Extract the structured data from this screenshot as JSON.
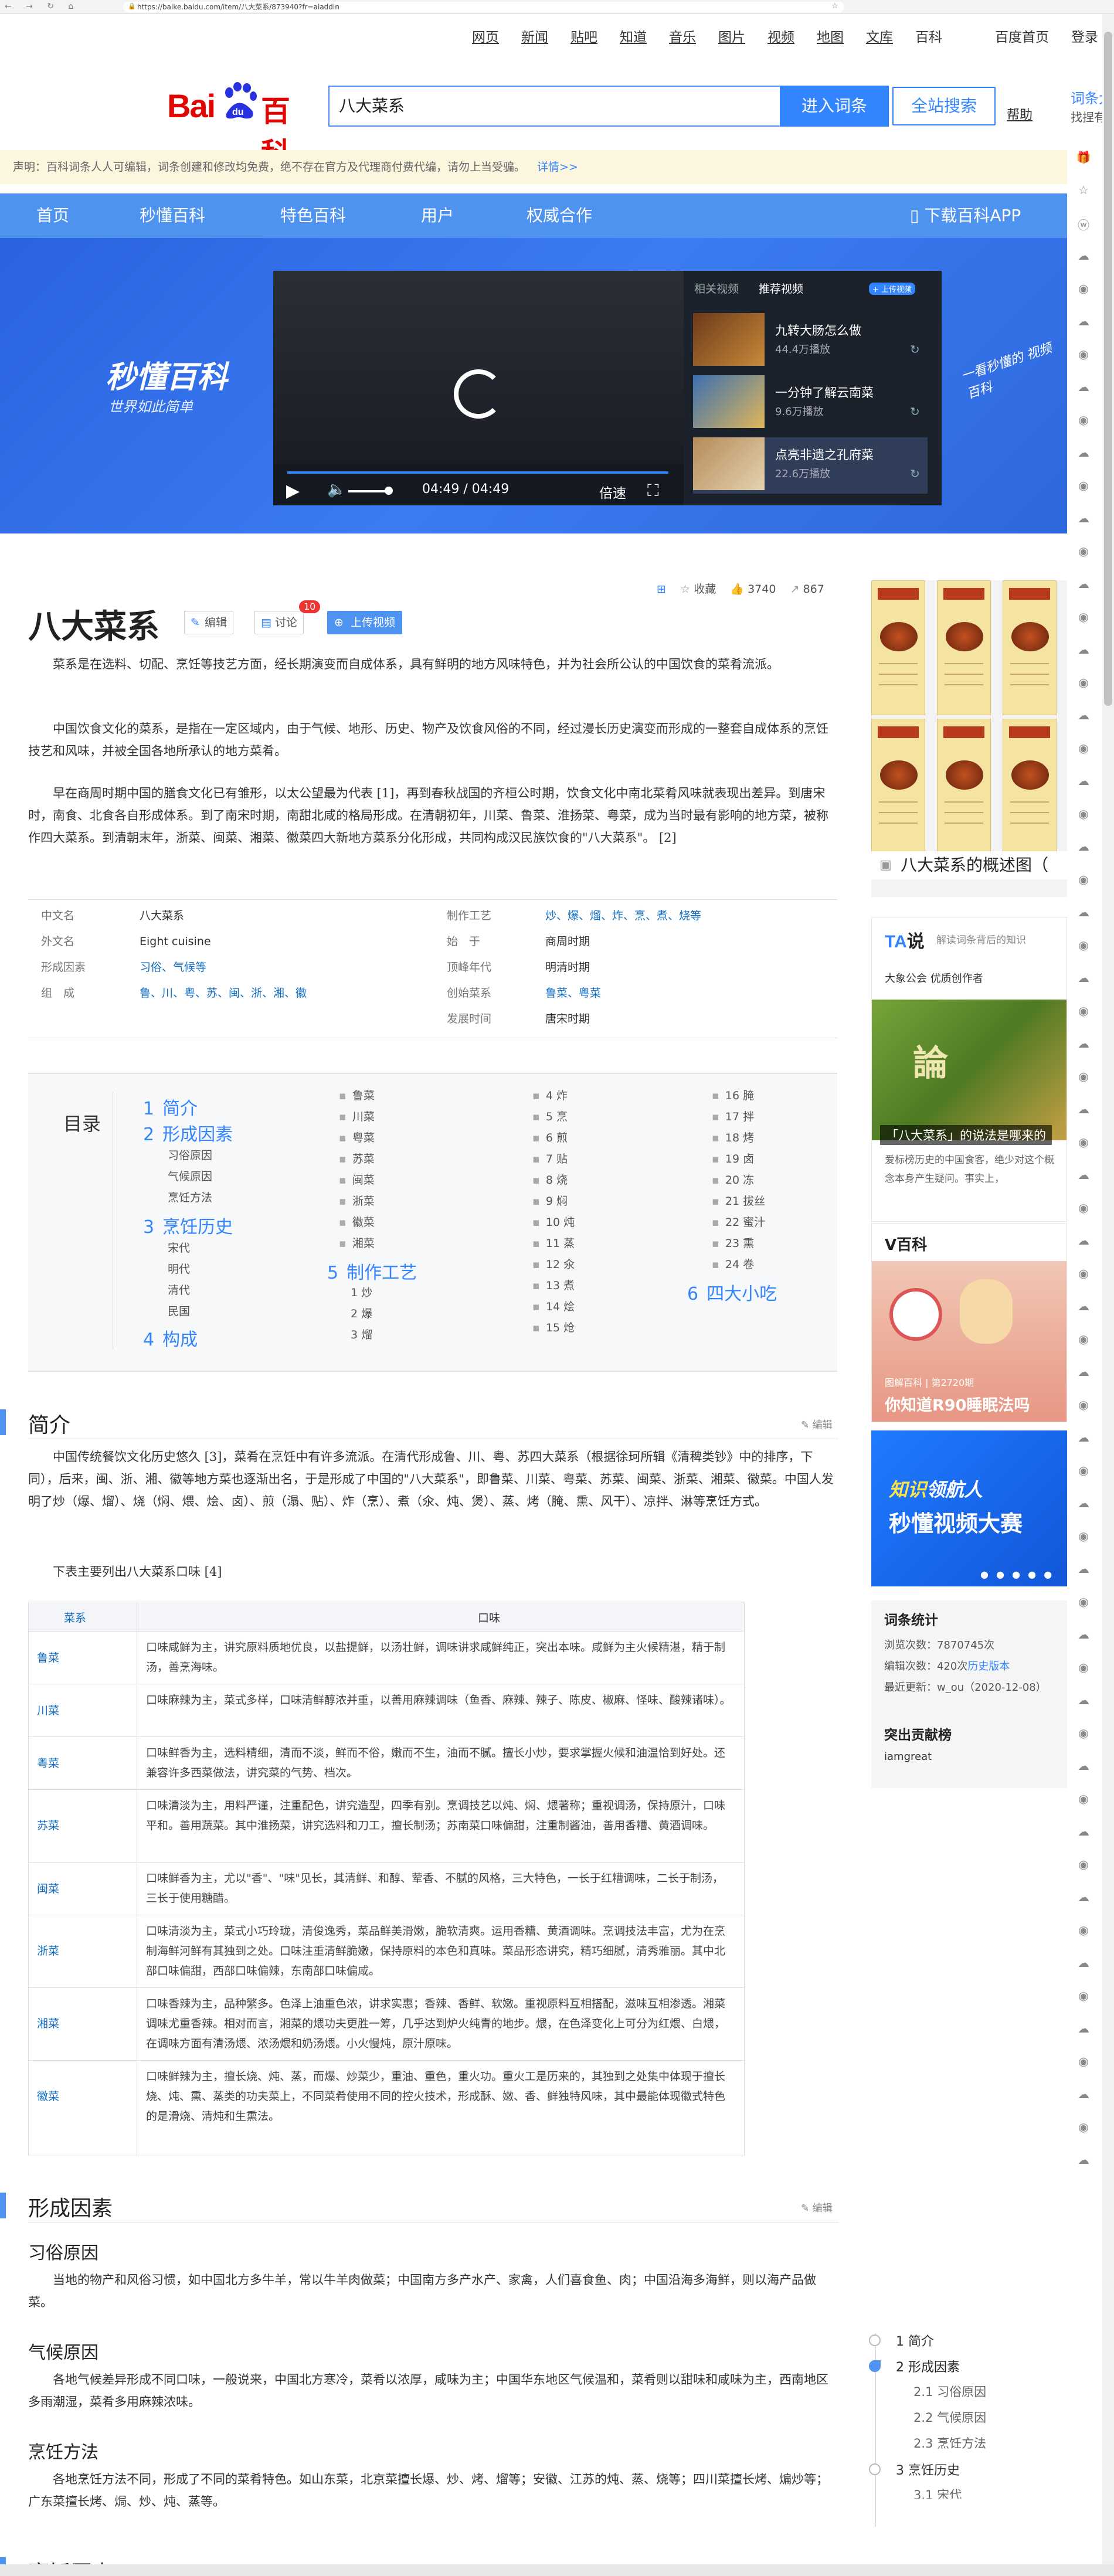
{
  "browser": {
    "url": "https://baike.baidu.com/item/八大菜系/873940?fr=aladdin",
    "nav_icons": "← → ↻ ⌂"
  },
  "toplinks": [
    {
      "label": "网页"
    },
    {
      "label": "新闻"
    },
    {
      "label": "贴吧"
    },
    {
      "label": "知道"
    },
    {
      "label": "音乐"
    },
    {
      "label": "图片"
    },
    {
      "label": "视频"
    },
    {
      "label": "地图"
    },
    {
      "label": "文库"
    },
    {
      "label": "百科"
    },
    {
      "label": "百度首页"
    },
    {
      "label": "登录"
    }
  ],
  "header": {
    "logo_bai": "Bai",
    "logo_du": "du",
    "logo_baike": "百科",
    "search_value": "八大菜系",
    "enter_button": "进入词条",
    "all_search_button": "全站搜索",
    "help": "帮助",
    "right_title": "词条大",
    "right_sub": "找捏有"
  },
  "notice": {
    "text": "声明：百科词条人人可编辑，词条创建和修改均免费，绝不存在官方及代理商付费代编，请勿上当受骗。",
    "more": "详情>>"
  },
  "nav": {
    "items": [
      {
        "label": "首页"
      },
      {
        "label": "秒懂百科"
      },
      {
        "label": "特色百科"
      },
      {
        "label": "用户"
      },
      {
        "label": "权威合作"
      }
    ],
    "download": "下载百科APP"
  },
  "banner": {
    "brand": "秒懂百科",
    "slogan": "世界如此简单",
    "handwriting": "一看秒懂的 视频百科",
    "player": {
      "time": "04:49 / 04:49",
      "speed": "倍速",
      "progress_fraction": 1.0
    },
    "video_tabs": {
      "related": "相关视频",
      "recommended": "推荐视频",
      "upload": "+ 上传视频"
    },
    "videos": [
      {
        "title": "九转大肠怎么做",
        "plays": "44.4万播放"
      },
      {
        "title": "一分钟了解云南菜",
        "plays": "9.6万播放"
      },
      {
        "title": "点亮非遗之孔府菜",
        "plays": "22.6万播放"
      }
    ]
  },
  "title_area": {
    "title": "八大菜系",
    "edit": "编辑",
    "discuss": "讨论",
    "discuss_badge": "10",
    "upload_video": "上传视频",
    "collect": "收藏",
    "likes": "3740",
    "shares": "867"
  },
  "intro_paragraphs": [
    "菜系是在选料、切配、烹饪等技艺方面，经长期演变而自成体系，具有鲜明的地方风味特色，并为社会所公认的中国饮食的菜肴流派。",
    "中国饮食文化的菜系，是指在一定区域内，由于气候、地形、历史、物产及饮食风俗的不同，经过漫长历史演变而形成的一整套自成体系的烹饪技艺和风味，并被全国各地所承认的地方菜肴。",
    "早在商周时期中国的膳食文化已有雏形，以太公望最为代表 [1]，再到春秋战国的齐桓公时期，饮食文化中南北菜肴风味就表现出差异。到唐宋时，南食、北食各自形成体系。到了南宋时期，南甜北咸的格局形成。在清朝初年，川菜、鲁菜、淮扬菜、粤菜，成为当时最有影响的地方菜，被称作四大菜系。到清朝末年，浙菜、闽菜、湘菜、徽菜四大新地方菜系分化形成，共同构成汉民族饮食的\"八大菜系\"。 [2]"
  ],
  "info": {
    "left": [
      {
        "key": "中文名",
        "value": "八大菜系"
      },
      {
        "key": "外文名",
        "value": "Eight cuisine"
      },
      {
        "key": "形成因素",
        "value": "习俗、气候等"
      },
      {
        "key": "组　成",
        "value": "鲁、川、粤、苏、闽、浙、湘、徽"
      }
    ],
    "right": [
      {
        "key": "制作工艺",
        "value": "炒、爆、熘、炸、烹、煮、烧等"
      },
      {
        "key": "始　于",
        "value": "商周时期"
      },
      {
        "key": "顶峰年代",
        "value": "明清时期"
      },
      {
        "key": "创始菜系",
        "value": "鲁菜、粤菜"
      },
      {
        "key": "发展时间",
        "value": "唐宋时期"
      }
    ]
  },
  "toc": {
    "label": "目录",
    "main": [
      {
        "n": "1",
        "label": "简介"
      },
      {
        "n": "2",
        "label": "形成因素"
      },
      {
        "n": "3",
        "label": "烹饪历史"
      },
      {
        "n": "4",
        "label": "构成"
      },
      {
        "n": "5",
        "label": "制作工艺"
      },
      {
        "n": "6",
        "label": "四大小吃"
      }
    ],
    "sub2": [
      "习俗原因",
      "气候原因",
      "烹饪方法"
    ],
    "sub3": [
      "宋代",
      "明代",
      "清代",
      "民国"
    ],
    "col2": [
      "鲁菜",
      "川菜",
      "粤菜",
      "苏菜",
      "闽菜",
      "浙菜",
      "徽菜",
      "湘菜"
    ],
    "sub5": [
      "1 炒",
      "2 爆",
      "3 熘"
    ],
    "col3": [
      "4 炸",
      "5 烹",
      "6 煎",
      "7 贴",
      "8 烧",
      "9 焖",
      "10 炖",
      "11 蒸",
      "12 氽",
      "13 煮",
      "14 烩",
      "15 炝"
    ],
    "col4": [
      "16 腌",
      "17 拌",
      "18 烤",
      "19 卤",
      "20 冻",
      "21 拔丝",
      "22 蜜汁",
      "23 熏",
      "24 卷"
    ]
  },
  "section1": {
    "title": "简介",
    "edit": "编辑",
    "para1": "中国传统餐饮文化历史悠久 [3]，菜肴在烹饪中有许多流派。在清代形成鲁、川、粤、苏四大菜系（根据徐珂所辑《清稗类钞》中的排序，下同），后来，闽、浙、湘、徽等地方菜也逐渐出名，于是形成了中国的\"八大菜系\"，即鲁菜、川菜、粤菜、苏菜、闽菜、浙菜、湘菜、徽菜。中国人发明了炒（爆、熘）、烧（焖、煨、烩、卤）、煎（溻、贴）、炸（烹）、煮（氽、炖、煲）、蒸、烤（腌、熏、风干）、凉拌、淋等烹饪方式。",
    "para2": "下表主要列出八大菜系口味 [4]"
  },
  "flavor_table": {
    "head_cuisine": "菜系",
    "head_taste": "口味",
    "rows": [
      {
        "k": "鲁菜",
        "v": "口味咸鲜为主，讲究原料质地优良，以盐提鲜，以汤壮鲜，调味讲求咸鲜纯正，突出本味。咸鲜为主火候精湛，精于制汤，善烹海味。"
      },
      {
        "k": "川菜",
        "v": "口味麻辣为主，菜式多样，口味清鲜醇浓并重，以善用麻辣调味（鱼香、麻辣、辣子、陈皮、椒麻、怪味、酸辣诸味）。"
      },
      {
        "k": "粤菜",
        "v": "口味鲜香为主，选料精细，清而不淡，鲜而不俗，嫩而不生，油而不腻。擅长小炒，要求掌握火候和油温恰到好处。还兼容许多西菜做法，讲究菜的气势、档次。"
      },
      {
        "k": "苏菜",
        "v": "口味清淡为主，用料严谨，注重配色，讲究造型，四季有别。烹调技艺以炖、焖、煨著称；重视调汤，保持原汁，口味平和。善用蔬菜。其中淮扬菜，讲究选料和刀工，擅长制汤；苏南菜口味偏甜，注重制酱油，善用香糟、黄酒调味。"
      },
      {
        "k": "闽菜",
        "v": "口味鲜香为主，尤以\"香\"、\"味\"见长，其清鲜、和醇、荤香、不腻的风格，三大特色，一长于红糟调味，二长于制汤，三长于使用糖醋。"
      },
      {
        "k": "浙菜",
        "v": "口味清淡为主，菜式小巧玲珑，清俊逸秀，菜品鲜美滑嫩，脆软清爽。运用香糟、黄酒调味。烹调技法丰富，尤为在烹制海鲜河鲜有其独到之处。口味注重清鲜脆嫩，保持原料的本色和真味。菜品形态讲究，精巧细腻，清秀雅丽。其中北部口味偏甜，西部口味偏辣，东南部口味偏咸。"
      },
      {
        "k": "湘菜",
        "v": "口味香辣为主，品种繁多。色泽上油重色浓，讲求实惠；香辣、香鲜、软嫩。重视原料互相搭配，滋味互相渗透。湘菜调味尤重香辣。相对而言，湘菜的煨功夫更胜一筹，几乎达到炉火纯青的地步。煨，在色泽变化上可分为红煨、白煨，在调味方面有清汤煨、浓汤煨和奶汤煨。小火慢炖，原汁原味。"
      },
      {
        "k": "徽菜",
        "v": "口味鲜辣为主，擅长烧、炖、蒸，而爆、炒菜少，重油、重色，重火功。重火工是历来的，其独到之处集中体现于擅长烧、炖、熏、蒸类的功夫菜上，不同菜肴使用不同的控火技术，形成酥、嫩、香、鲜独特风味，其中最能体现徽式特色的是滑烧、清炖和生熏法。"
      }
    ]
  },
  "section2": {
    "title": "形成因素",
    "edit": "编辑",
    "sub1": "习俗原因",
    "sub1_text": "当地的物产和风俗习惯，如中国北方多牛羊，常以牛羊肉做菜；中国南方多产水产、家禽，人们喜食鱼、肉；中国沿海多海鲜，则以海产品做菜。",
    "sub2": "气候原因",
    "sub2_text": "各地气候差异形成不同口味，一般说来，中国北方寒冷，菜肴以浓厚，咸味为主；中国华东地区气候温和，菜肴则以甜味和咸味为主，西南地区多雨潮湿，菜肴多用麻辣浓味。",
    "sub3": "烹饪方法",
    "sub3_text": "各地烹饪方法不同，形成了不同的菜肴特色。如山东菜，北京菜擅长爆、炒、烤、熘等；安徽、江苏的炖、蒸、烧等；四川菜擅长烤、煸炒等；广东菜擅长烤、焗、炒、炖、蒸等。",
    "next_title": "烹饪历史"
  },
  "right": {
    "album_caption": "八大菜系的概述图（",
    "tashuo": {
      "logo_a": "TA",
      "logo_b": "说",
      "tag": "解读词条背后的知识",
      "author": "大象公会  优质创作者",
      "img_text": "論",
      "caption": "「八大菜系」的说法是哪来的",
      "desc": "爱标榜历史的中国食客，绝少对这个概念本身产生疑问。事实上，"
    },
    "vbaike": {
      "title": "V百科",
      "tag": "图解百科 | 第2720期",
      "caption": "你知道R90睡眠法吗"
    },
    "zhishi": {
      "a": "知识",
      "b": "领航人",
      "line2": "秒懂视频大赛",
      "dots": "● ● ● ● ●"
    },
    "stats": {
      "title": "词条统计",
      "views_label": "浏览次数：",
      "views": "7870745次",
      "edits_label": "编辑次数：",
      "edits": "420次",
      "history": "历史版本",
      "updated_label": "最近更新：",
      "updated": "w_ou（2020-12-08）",
      "contrib_title": "突出贡献榜",
      "contrib_user": "iamgreat"
    }
  },
  "float_toc": [
    {
      "level": 1,
      "label": "1  简介"
    },
    {
      "level": 1,
      "label": "2  形成因素",
      "active": true
    },
    {
      "level": 2,
      "label": "2.1  习俗原因"
    },
    {
      "level": 2,
      "label": "2.2  气候原因"
    },
    {
      "level": 2,
      "label": "2.3  烹饪方法"
    },
    {
      "level": 1,
      "label": "3  烹饪历史"
    },
    {
      "level": 2,
      "label": "3.1  宋代"
    }
  ]
}
